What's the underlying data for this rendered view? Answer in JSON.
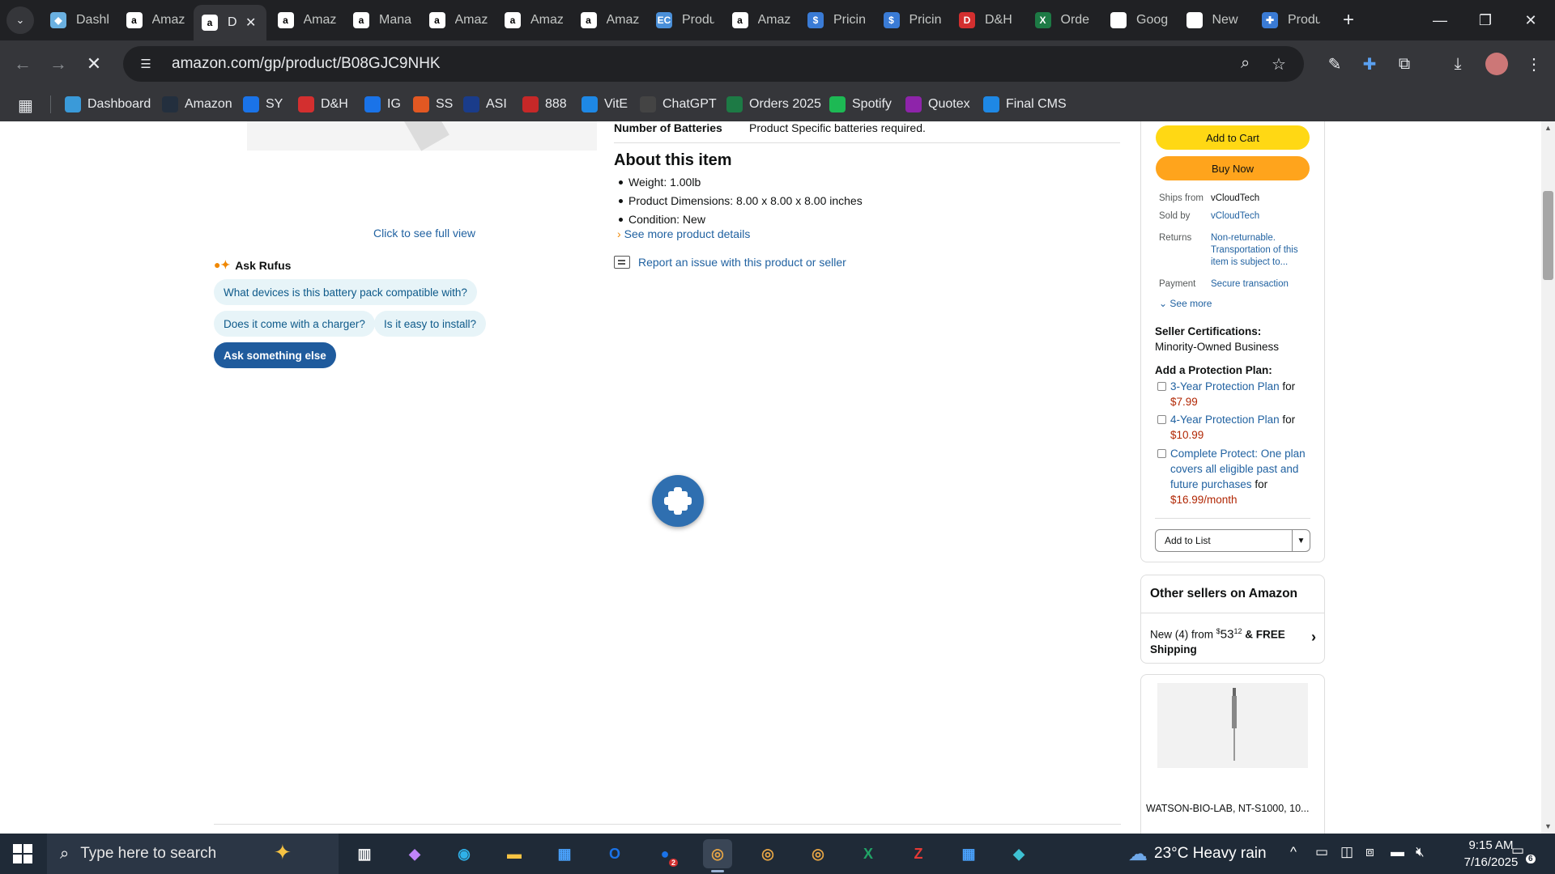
{
  "browser": {
    "tabs": [
      {
        "title": "Dashl",
        "icon": "generic-icon",
        "color": "#6ab0e0"
      },
      {
        "title": "Amaz",
        "icon": "amazon-icon",
        "color": "#ffffff"
      },
      {
        "title": "D",
        "icon": "amazon-icon",
        "color": "#ffffff"
      },
      {
        "title": "Amaz",
        "icon": "amazon-icon",
        "color": "#ffffff"
      },
      {
        "title": "Mana",
        "icon": "amazon-icon",
        "color": "#ffffff"
      },
      {
        "title": "Amaz",
        "icon": "amazon-icon",
        "color": "#ffffff"
      },
      {
        "title": "Amaz",
        "icon": "amazon-icon",
        "color": "#ffffff"
      },
      {
        "title": "Amaz",
        "icon": "amazon-icon",
        "color": "#ffffff"
      },
      {
        "title": "Produ",
        "icon": "ec-icon",
        "color": "#4a8fd8"
      },
      {
        "title": "Amaz",
        "icon": "amazon-icon",
        "color": "#ffffff"
      },
      {
        "title": "Pricin",
        "icon": "dollar-icon",
        "color": "#3a7bd5"
      },
      {
        "title": "Pricin",
        "icon": "dollar-icon",
        "color": "#3a7bd5"
      },
      {
        "title": "D&H",
        "icon": "dh-icon",
        "color": "#d32f2f"
      },
      {
        "title": "Orde",
        "icon": "excel-icon",
        "color": "#1d7a45"
      },
      {
        "title": "Goog",
        "icon": "google-icon",
        "color": "#ffffff"
      },
      {
        "title": "New",
        "icon": "chatgpt-icon",
        "color": "#ffffff"
      },
      {
        "title": "Produ",
        "icon": "gear-icon",
        "color": "#3a7bd5"
      }
    ],
    "url": "amazon.com/gp/product/B08GJC9NHK"
  },
  "bookmarks": [
    {
      "label": "Dashboard",
      "color": "#3a9ad9"
    },
    {
      "label": "Amazon",
      "color": "#232f3e"
    },
    {
      "label": "SY",
      "color": "#1a73e8"
    },
    {
      "label": "D&H",
      "color": "#d32f2f"
    },
    {
      "label": "IG",
      "color": "#1a73e8"
    },
    {
      "label": "SS",
      "color": "#e25822"
    },
    {
      "label": "ASI",
      "color": "#1a3c8a"
    },
    {
      "label": "888",
      "color": "#c62828"
    },
    {
      "label": "VitE",
      "color": "#1e88e5"
    },
    {
      "label": "ChatGPT",
      "color": "#444444"
    },
    {
      "label": "Orders 2025",
      "color": "#1d7a45"
    },
    {
      "label": "Spotify",
      "color": "#1db954"
    },
    {
      "label": "Quotex",
      "color": "#8e24aa"
    },
    {
      "label": "Final CMS",
      "color": "#1e88e5"
    }
  ],
  "product": {
    "full_view_link": "Click to see full view",
    "rufus": {
      "title": "Ask Rufus",
      "chips": [
        "What devices is this battery pack compatible with?",
        "Does it come with a charger?",
        "Is it easy to install?"
      ],
      "ask_else": "Ask something else"
    },
    "spec": {
      "key": "Number of Batteries",
      "value": "Product Specific batteries required."
    },
    "about_title": "About this item",
    "bullets": [
      "Weight: 1.00lb",
      "Product Dimensions: 8.00 x 8.00 x 8.00 inches",
      "Condition: New"
    ],
    "more_details": "See more product details",
    "report": "Report an issue with this product or seller"
  },
  "buybox": {
    "add_to_cart": "Add to Cart",
    "buy_now": "Buy Now",
    "ships_from_label": "Ships from",
    "ships_from": "vCloudTech",
    "sold_by_label": "Sold by",
    "sold_by": "vCloudTech",
    "returns_label": "Returns",
    "returns": "Non-returnable. Transportation of this item is subject to...",
    "payment_label": "Payment",
    "payment": "Secure transaction",
    "see_more": "See more",
    "cert_title": "Seller Certifications:",
    "cert_value": "Minority-Owned Business",
    "protection_title": "Add a Protection Plan:",
    "plans": [
      {
        "name": "3-Year Protection Plan",
        "for": "for",
        "price": "$7.99"
      },
      {
        "name": "4-Year Protection Plan",
        "for": "for",
        "price": "$10.99"
      },
      {
        "name": "Complete Protect: One plan covers all eligible past and future purchases",
        "for": "for",
        "price": "$16.99/month"
      }
    ],
    "add_to_list": "Add to List"
  },
  "other_sellers": {
    "title": "Other sellers on Amazon",
    "offer_prefix": "New (4) from",
    "price_symbol": "$",
    "price_whole": "53",
    "price_fraction": "12",
    "offer_suffix": "& FREE Shipping"
  },
  "recommendation": {
    "name": "WATSON-BIO-LAB, NT-S1000, 10..."
  },
  "taskbar": {
    "search_placeholder": "Type here to search",
    "weather": "23°C  Heavy rain",
    "time": "9:15 AM",
    "date": "7/16/2025",
    "notification_count": "6",
    "outlook_badge": "2"
  }
}
